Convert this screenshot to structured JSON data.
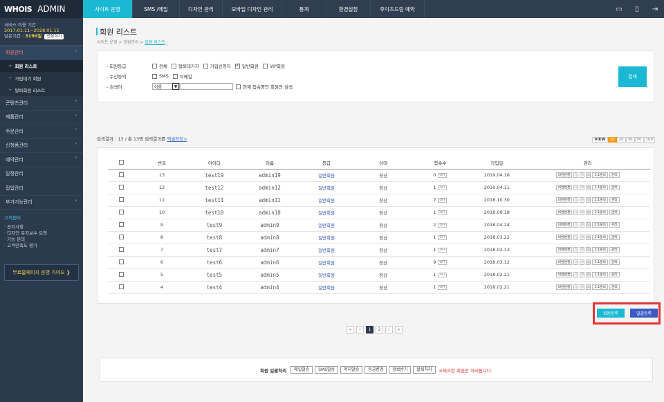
{
  "brand": {
    "logo": "WHOIS",
    "admin": "ADMIN"
  },
  "service": {
    "label": "서비스 이용 기간",
    "period": "2017.01.11~2028.01.11",
    "remain_label": "남은기간 :",
    "remain_value": "3190일",
    "extend": "연장하기"
  },
  "sidebar": {
    "menus": [
      {
        "label": "회원관리",
        "active": true
      },
      {
        "label": "콘텐츠관리"
      },
      {
        "label": "제품관리"
      },
      {
        "label": "주문관리"
      },
      {
        "label": "신청폼관리"
      },
      {
        "label": "예약관리"
      },
      {
        "label": "일정관리"
      },
      {
        "label": "접업관리"
      },
      {
        "label": "부가기능관리"
      }
    ],
    "submenus": [
      {
        "label": "회원 리스트",
        "active": true
      },
      {
        "label": "가입대기 회원"
      },
      {
        "label": "탈퇴회원 리스트"
      }
    ],
    "cs": {
      "title": "고객센터",
      "items": [
        "공지사항",
        "디자인 유지보수 요청",
        "기능 문의",
        "고객만족도 평가"
      ]
    },
    "guide": "무료홈페이지 운영 가이드 ❯"
  },
  "topnav": {
    "tabs": [
      "사이트 운영",
      "SMS /메일",
      "디자인 관리",
      "모바일 디자인 관리",
      "통계",
      "환경설정",
      "후이즈드림 예약"
    ],
    "active": 0
  },
  "page": {
    "title": "회원 리스트",
    "crumb": [
      "사이트 운영",
      "회원관리"
    ],
    "crumb_current": "회원 리스트"
  },
  "search": {
    "grade_label": "회원등급",
    "grades": [
      {
        "label": "전체",
        "checked": false
      },
      {
        "label": "탈퇴대기자",
        "checked": false
      },
      {
        "label": "가입신청자",
        "checked": false
      },
      {
        "label": "일반회원",
        "checked": true
      },
      {
        "label": "VIP회원",
        "checked": false
      }
    ],
    "consent_label": "수신동의",
    "consents": [
      "SMS",
      "이메일"
    ],
    "keyword_label": "검색어",
    "keyword_select": "이름",
    "online_only": "현재 접속중인 회원만 검색",
    "button": "검색"
  },
  "result": {
    "text": "검색결과 : 13 / 총 13명 검색결과를",
    "link": "엑셀저장>"
  },
  "view": {
    "label": "VIEW",
    "options": [
      "10",
      "20",
      "30",
      "50",
      "100"
    ],
    "active": "10"
  },
  "table": {
    "headers": [
      "번호",
      "아이디",
      "이름",
      "등급",
      "상태",
      "접속수",
      "가입일",
      "관리"
    ],
    "off": "OFF",
    "mgmt": [
      "비번변경",
      "1:1문의",
      "관리"
    ],
    "rows": [
      {
        "no": "13",
        "id": "test19",
        "name": "admin19",
        "grade": "일반회원",
        "status": "정상",
        "visits": "0",
        "date": "2019.04.18"
      },
      {
        "no": "12",
        "id": "test12",
        "name": "admin12",
        "grade": "일반회원",
        "status": "정상",
        "visits": "1",
        "date": "2019.04.11"
      },
      {
        "no": "11",
        "id": "test11",
        "name": "admin11",
        "grade": "일반회원",
        "status": "정상",
        "visits": "7",
        "date": "2018.10.30"
      },
      {
        "no": "10",
        "id": "test10",
        "name": "admin10",
        "grade": "일반회원",
        "status": "정상",
        "visits": "1",
        "date": "2018.09.18"
      },
      {
        "no": "9",
        "id": "test9",
        "name": "admin9",
        "grade": "일반회원",
        "status": "정상",
        "visits": "2",
        "date": "2018.04.24"
      },
      {
        "no": "8",
        "id": "test8",
        "name": "admin8",
        "grade": "일반회원",
        "status": "정상",
        "visits": "1",
        "date": "2018.03.22"
      },
      {
        "no": "7",
        "id": "test7",
        "name": "admin7",
        "grade": "일반회원",
        "status": "정상",
        "visits": "1",
        "date": "2018.03.13"
      },
      {
        "no": "6",
        "id": "test6",
        "name": "admin6",
        "grade": "일반회원",
        "status": "정상",
        "visits": "9",
        "date": "2018.03.12"
      },
      {
        "no": "5",
        "id": "test5",
        "name": "admin5",
        "grade": "일반회원",
        "status": "정상",
        "visits": "1",
        "date": "2018.02.21"
      },
      {
        "no": "4",
        "id": "test4",
        "name": "admin4",
        "grade": "일반회원",
        "status": "정상",
        "visits": "1",
        "date": "2018.02.21"
      }
    ]
  },
  "actions": {
    "register": "회원등록",
    "bulk_register": "일괄등록",
    "register_color": "#1ab8d3",
    "bulk_color": "#3b5bc4"
  },
  "pager": {
    "pages": [
      "«",
      "‹",
      "1",
      "2",
      "›",
      "»"
    ],
    "current": "1"
  },
  "bulk": {
    "title": "회원 일괄처리",
    "buttons": [
      "메일발송",
      "SMS발송",
      "쪽지발송",
      "등급변경",
      "정보받기",
      "탈퇴처리"
    ],
    "note": "※체크한 회원만 처리됩니다."
  }
}
